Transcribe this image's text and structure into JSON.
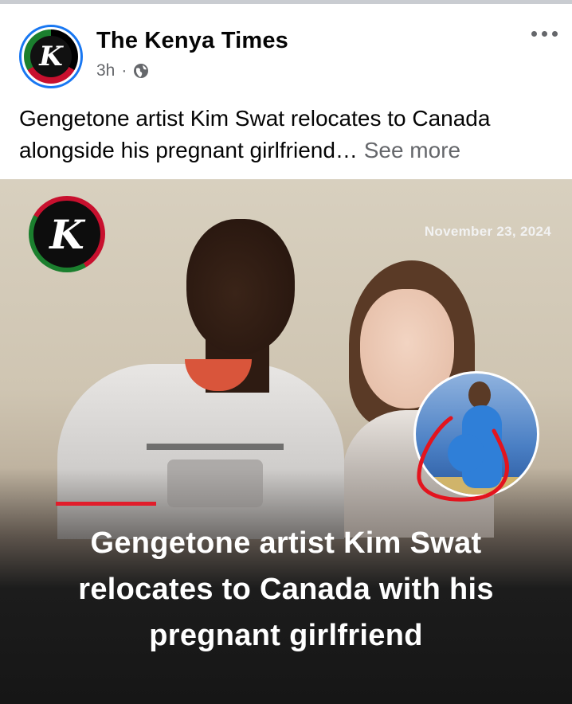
{
  "post": {
    "page_name": "The Kenya Times",
    "time": "3h",
    "separator": "·",
    "privacy_icon": "globe-icon",
    "more_icon": "more-dots-icon",
    "avatar_letter": "K",
    "caption": "Gengetone artist Kim Swat relocates to Canada alongside his pregnant girlfriend…",
    "see_more": "See more"
  },
  "image": {
    "logo_letter": "K",
    "date": "November 23, 2024",
    "headline": "Gengetone artist Kim Swat relocates to Canada with his pregnant girlfriend",
    "accent_color": "#e11d2b"
  },
  "colors": {
    "brand_blue": "#1877f2",
    "meta_gray": "#65676b"
  }
}
